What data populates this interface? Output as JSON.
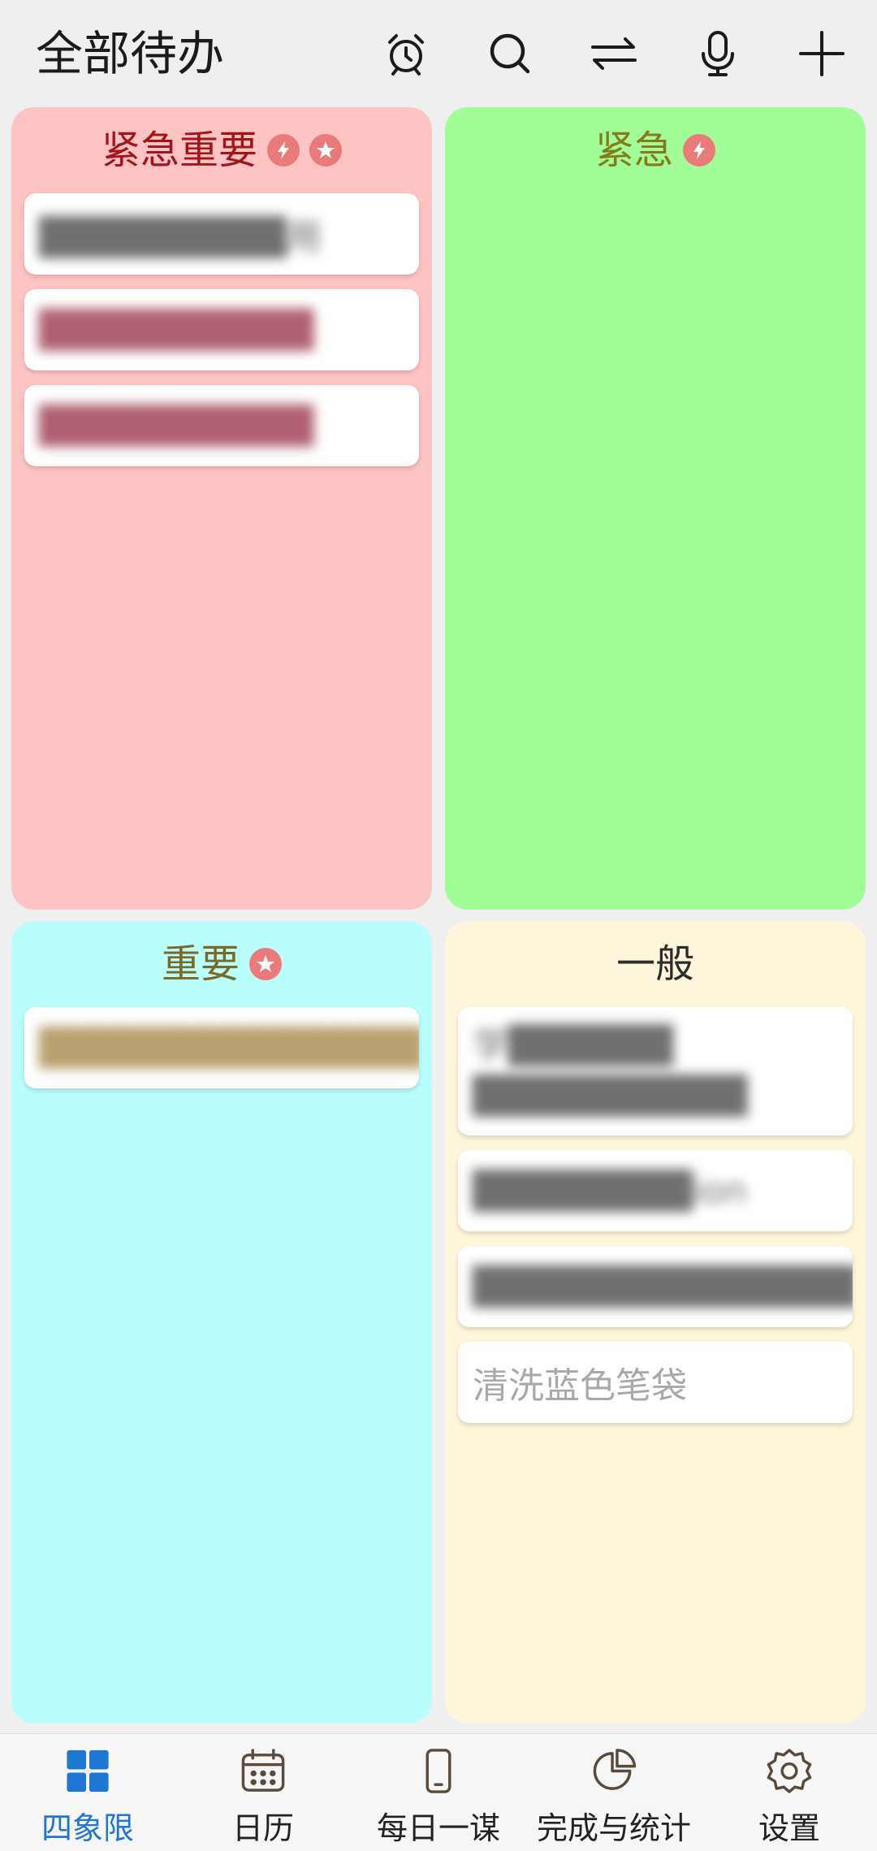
{
  "header": {
    "title": "全部待办",
    "icons": [
      "alarm-icon",
      "search-icon",
      "swap-icon",
      "microphone-icon",
      "add-icon"
    ]
  },
  "quadrants": {
    "urgent_important": {
      "title": "紧急重要",
      "badges": [
        "bolt-icon",
        "star-icon"
      ],
      "tasks": [
        "█████████用",
        "██████████",
        "██████████"
      ]
    },
    "urgent": {
      "title": "紧急",
      "badges": [
        "bolt-icon"
      ],
      "tasks": []
    },
    "important": {
      "title": "重要",
      "badges": [
        "star-icon"
      ],
      "tasks": [
        "██████████████"
      ]
    },
    "normal": {
      "title": "一般",
      "tasks": [
        "学██████\n██████████",
        "████████ion",
        "██████████████",
        "清洗蓝色笔袋"
      ]
    }
  },
  "nav": {
    "items": [
      {
        "label": "四象限",
        "icon": "grid-icon",
        "active": true
      },
      {
        "label": "日历",
        "icon": "calendar-icon",
        "active": false
      },
      {
        "label": "每日一谋",
        "icon": "phone-icon",
        "active": false
      },
      {
        "label": "完成与统计",
        "icon": "pie-chart-icon",
        "active": false
      },
      {
        "label": "设置",
        "icon": "gear-icon",
        "active": false
      }
    ]
  },
  "colors": {
    "urgent_important_bg": "#fec3c3",
    "urgent_bg": "#a1fd98",
    "important_bg": "#bafdfd",
    "normal_bg": "#fef6da",
    "accent": "#1f77d4",
    "badge": "#ea7a7a"
  }
}
